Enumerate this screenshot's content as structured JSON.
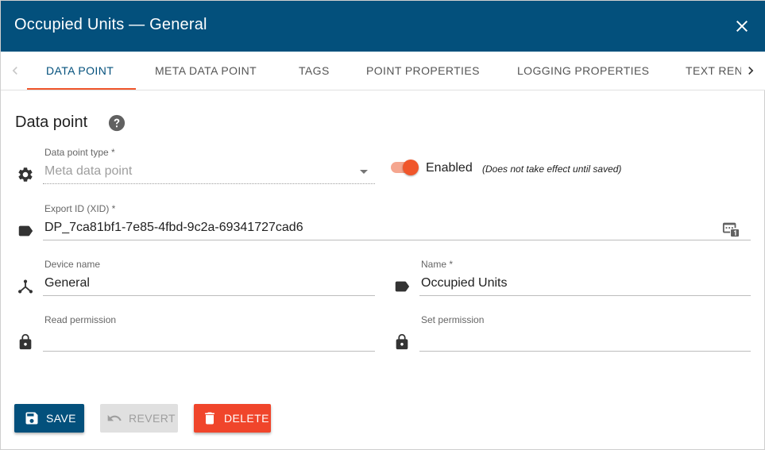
{
  "dialog": {
    "title": "Occupied Units — General"
  },
  "tabs": [
    {
      "label": "Data point",
      "active": true
    },
    {
      "label": "Meta data point",
      "active": false
    },
    {
      "label": "Tags",
      "active": false
    },
    {
      "label": "Point properties",
      "active": false
    },
    {
      "label": "Logging properties",
      "active": false
    },
    {
      "label": "Text ren",
      "active": false
    }
  ],
  "section": {
    "title": "Data point"
  },
  "fields": {
    "data_point_type": {
      "label": "Data point type *",
      "value": "Meta data point"
    },
    "enabled": {
      "label": "Enabled",
      "note": "(Does not take effect until saved)",
      "on": true
    },
    "export_id": {
      "label": "Export ID (XID) *",
      "value": "DP_7ca81bf1-7e85-4fbd-9c2a-69341727cad6"
    },
    "device_name": {
      "label": "Device name",
      "value": "General"
    },
    "name": {
      "label": "Name *",
      "value": "Occupied Units"
    },
    "read_permission": {
      "label": "Read permission",
      "value": ""
    },
    "set_permission": {
      "label": "Set permission",
      "value": ""
    }
  },
  "buttons": {
    "save": "Save",
    "revert": "Revert",
    "delete": "Delete"
  },
  "colors": {
    "primary": "#03507c",
    "accent": "#f0562b",
    "delete": "#f0452b"
  }
}
